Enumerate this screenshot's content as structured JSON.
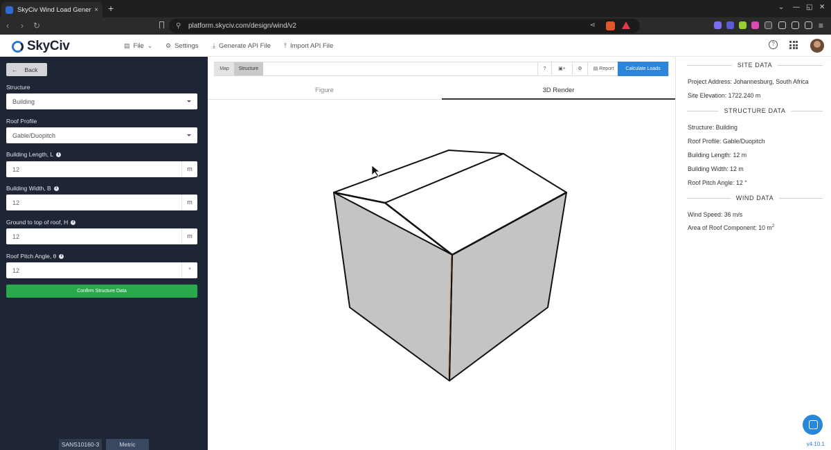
{
  "browser": {
    "tab_title": "SkyCiv Wind Load Generator",
    "tab_close": "×",
    "new_tab": "+",
    "url": "platform.skyciv.com/design/wind/v2",
    "window_controls": [
      "⌄",
      "—",
      "◱",
      "✕"
    ]
  },
  "header": {
    "logo": "SkyCiv",
    "menu": [
      {
        "label": "File",
        "icon": "file-icon"
      },
      {
        "label": "Settings",
        "icon": "settings-icon"
      },
      {
        "label": "Generate API File",
        "icon": "download-icon"
      },
      {
        "label": "Import API File",
        "icon": "upload-icon"
      }
    ],
    "help": "?"
  },
  "left": {
    "back_label": "Back",
    "structure_label": "Structure",
    "structure_value": "Building",
    "roof_profile_label": "Roof Profile",
    "roof_profile_value": "Gable/Duopitch",
    "length_label": "Building Length, L",
    "length_value": "12",
    "length_unit": "m",
    "width_label": "Building Width, B",
    "width_value": "12",
    "width_unit": "m",
    "height_label": "Ground to top of roof, H",
    "height_value": "12",
    "height_unit": "m",
    "pitch_label": "Roof Pitch Angle, θ",
    "pitch_value": "12",
    "pitch_unit": "°",
    "confirm_label": "Confirm Structure Data",
    "design_code": "SANS10160-3",
    "unit_system": "Metric"
  },
  "center": {
    "toolbar": {
      "map": "Map",
      "structure": "Structure",
      "help": "?",
      "settings": "⚙",
      "report": "Report",
      "calculate": "Calculate Loads"
    },
    "tabs": [
      "Figure",
      "3D Render"
    ],
    "active_tab": "3D Render"
  },
  "right": {
    "site_heading": "SITE DATA",
    "project_address": "Project Address: Johannesburg, South Africa",
    "site_elevation": "Site Elevation: 1722.240 m",
    "structure_heading": "STRUCTURE DATA",
    "structure": "Structure: Building",
    "roof_profile": "Roof Profile: Gable/Duopitch",
    "building_length": "Building Length: 12 m",
    "building_width": "Building Width: 12 m",
    "roof_pitch": "Roof Pitch Angle: 12 °",
    "wind_heading": "WIND DATA",
    "wind_speed": "Wind Speed: 36 m/s",
    "roof_component": "Area of Roof Component: 10 m",
    "roof_component_sup": "2",
    "version": "v4.10.1"
  },
  "colors": {
    "accent": "#2b85d8",
    "confirm": "#2aa84c",
    "sidebar": "#1e2534",
    "wall": "#c4c4c4"
  }
}
